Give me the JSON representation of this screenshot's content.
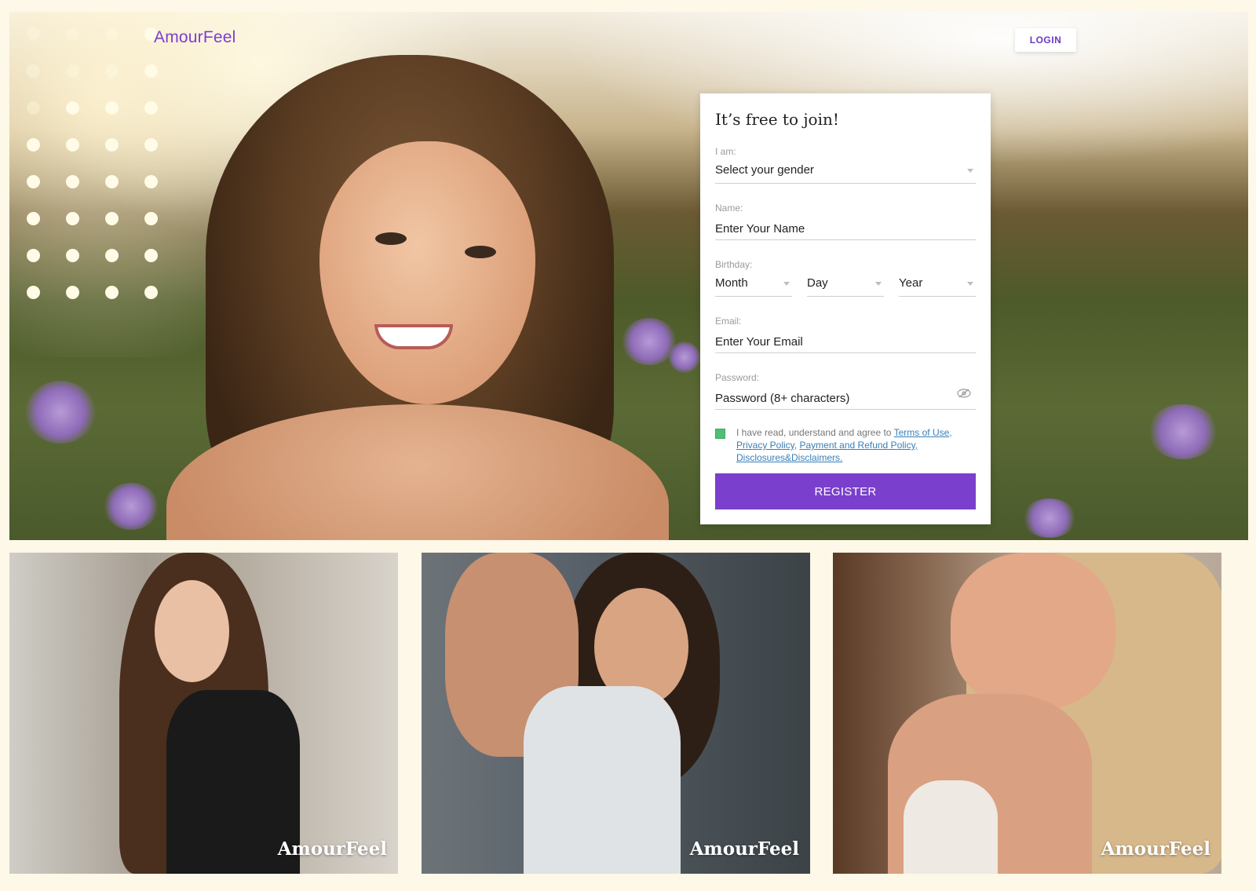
{
  "header": {
    "brand": "AmourFeel",
    "login_label": "LOGIN"
  },
  "form": {
    "title": "It’s free to join!",
    "gender": {
      "label": "I am:",
      "value": "Select your gender"
    },
    "name": {
      "label": "Name:",
      "placeholder": "Enter Your Name"
    },
    "birthday": {
      "label": "Birthday:",
      "month": "Month",
      "day": "Day",
      "year": "Year"
    },
    "email": {
      "label": "Email:",
      "placeholder": "Enter Your Email"
    },
    "password": {
      "label": "Password:",
      "placeholder": "Password (8+ characters)"
    },
    "agree": {
      "prefix": "I have read, understand and agree to ",
      "terms": "Terms of Use,",
      "privacy": "Privacy Policy,",
      "refund": "Payment and Refund Policy,",
      "disclosures": "Disclosures&Disclaimers."
    },
    "register_label": "REGISTER"
  },
  "gallery": [
    {
      "watermark": "AmourFeel"
    },
    {
      "watermark": "AmourFeel"
    },
    {
      "watermark": "AmourFeel"
    }
  ],
  "colors": {
    "accent": "#7a3fcc",
    "background": "#fdf8e7",
    "checkbox": "#4fbf73",
    "link": "#3a7fb6"
  },
  "icons": {
    "password_toggle": "eye-slash-icon",
    "select_caret": "chevron-down-icon"
  }
}
